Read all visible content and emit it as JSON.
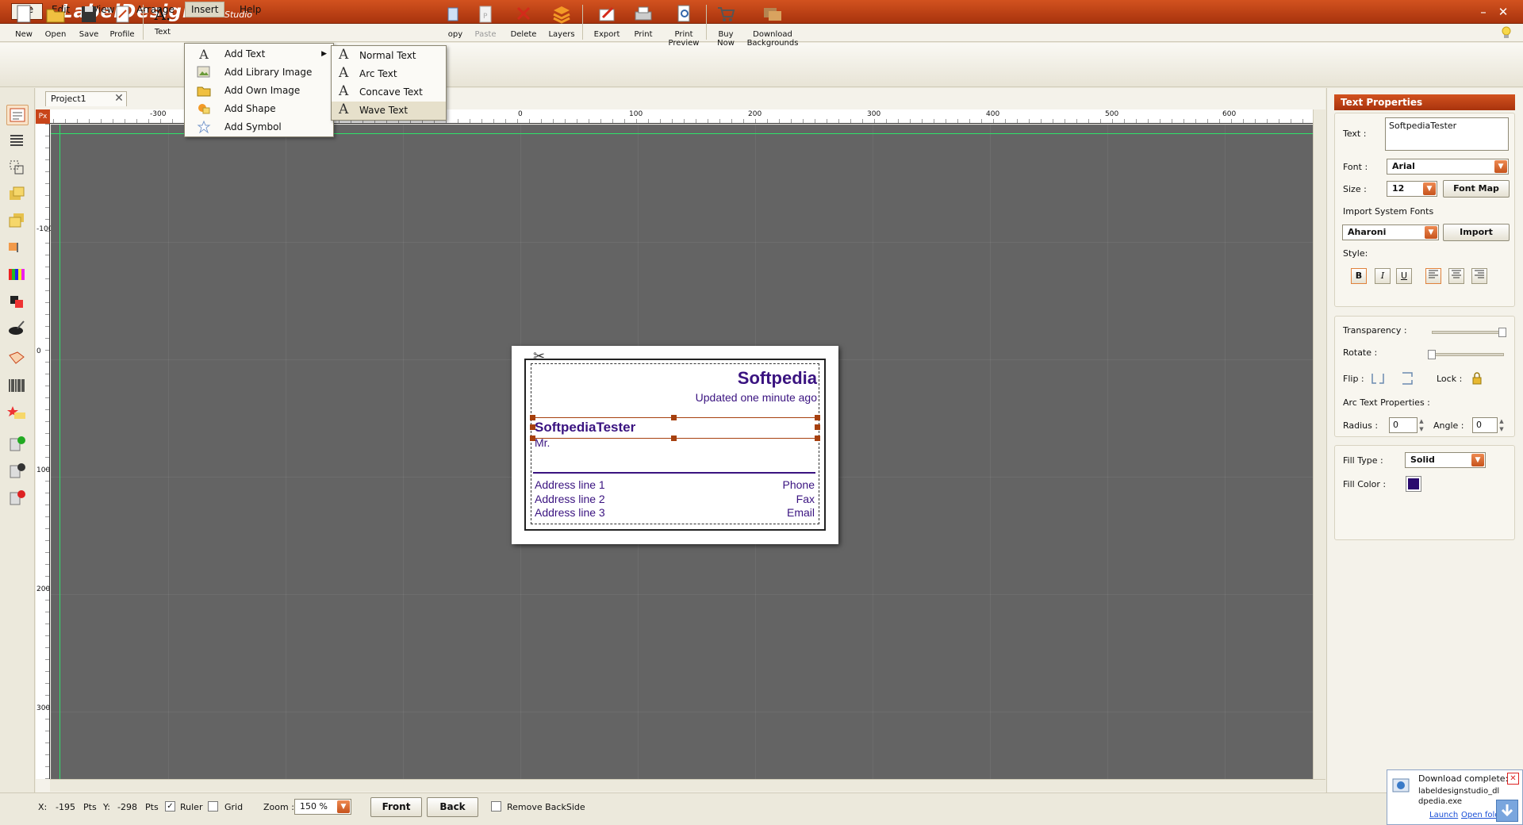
{
  "app": {
    "title": "LabelDesign",
    "subtitle": "Studio",
    "logo": "Z",
    "minimize": "–",
    "close": "✕"
  },
  "menubar": {
    "items": [
      {
        "label": "File"
      },
      {
        "label": "Edit"
      },
      {
        "label": "View"
      },
      {
        "label": "Arrange"
      },
      {
        "label": "Insert",
        "active": true
      },
      {
        "label": "Help"
      }
    ]
  },
  "toolbar": {
    "new": "New",
    "open": "Open",
    "save": "Save",
    "profile": "Profile",
    "text": "Text",
    "copy": "opy",
    "paste": "Paste",
    "delete": "Delete",
    "layers": "Layers",
    "export": "Export",
    "print": "Print",
    "print_preview": [
      "Print",
      "Preview"
    ],
    "buy_now": [
      "Buy",
      "Now"
    ],
    "download_backgrounds": [
      "Download",
      "Backgrounds"
    ]
  },
  "insert_menu": {
    "items": [
      {
        "label": "Add Text",
        "icon": "text-a-icon",
        "has_submenu": true
      },
      {
        "label": "Add Library Image",
        "icon": "library-image-icon"
      },
      {
        "label": "Add Own Image",
        "icon": "own-image-icon"
      },
      {
        "label": "Add Shape",
        "icon": "shape-icon"
      },
      {
        "label": "Add Symbol",
        "icon": "symbol-icon"
      }
    ]
  },
  "text_submenu": {
    "items": [
      {
        "label": "Normal Text"
      },
      {
        "label": "Arc Text"
      },
      {
        "label": "Concave Text"
      },
      {
        "label": "Wave Text",
        "highlighted": true
      }
    ]
  },
  "document": {
    "tab": "Project1",
    "tab_close": "✕",
    "unit": "Px",
    "hruler_labels": [
      "-300",
      "0",
      "100",
      "200",
      "300",
      "400",
      "500",
      "600"
    ],
    "vruler_labels": [
      "-100",
      "0",
      "100",
      "200",
      "300"
    ]
  },
  "label": {
    "company": "Softpedia",
    "updated": "Updated one minute ago",
    "name": "SoftpediaTester",
    "title": "Mr.",
    "address": [
      "Address line 1",
      "Address line 2",
      "Address line 3"
    ],
    "contact": [
      "Phone",
      "Fax",
      "Email"
    ],
    "text_color": "#3a1380"
  },
  "properties": {
    "header": "Text Properties",
    "text_label": "Text :",
    "text_value": "SoftpediaTester",
    "font_label": "Font :",
    "font_value": "Arial",
    "size_label": "Size :",
    "size_value": "12",
    "font_map": "Font Map",
    "import_system_fonts": "Import System Fonts",
    "import_font_value": "Aharoni",
    "import_button": "Import",
    "style_label": "Style:",
    "bold": "B",
    "italic": "I",
    "underline": "U",
    "transparency_label": "Transparency :",
    "rotate_label": "Rotate :",
    "flip_label": "Flip :",
    "lock_label": "Lock :",
    "arc_text_properties": "Arc Text Properties :",
    "radius_label": "Radius :",
    "radius_value": "0",
    "angle_label": "Angle :",
    "angle_value": "0",
    "fill_type_label": "Fill Type :",
    "fill_type_value": "Solid",
    "fill_color_label": "Fill Color :",
    "fill_color": "#2a0a6e"
  },
  "statusbar": {
    "x_label": "X:",
    "x_value": "-195",
    "x_unit": "Pts",
    "y_label": "Y:",
    "y_value": "-298",
    "y_unit": "Pts",
    "ruler": "Ruler",
    "ruler_checked": "✓",
    "grid": "Grid",
    "zoom_label": "Zoom :",
    "zoom_value": "150 %",
    "front": "Front",
    "back": "Back",
    "remove_backside": "Remove BackSide"
  },
  "download": {
    "title": "Download complete:",
    "filename": "labeldesignstudio_dldpedia.exe",
    "launch": "Launch",
    "open_folder": "Open folder",
    "close": "✕"
  },
  "colors": {
    "accent": "#c8451a",
    "canvas": "#646464",
    "guide": "#2ee36a"
  }
}
